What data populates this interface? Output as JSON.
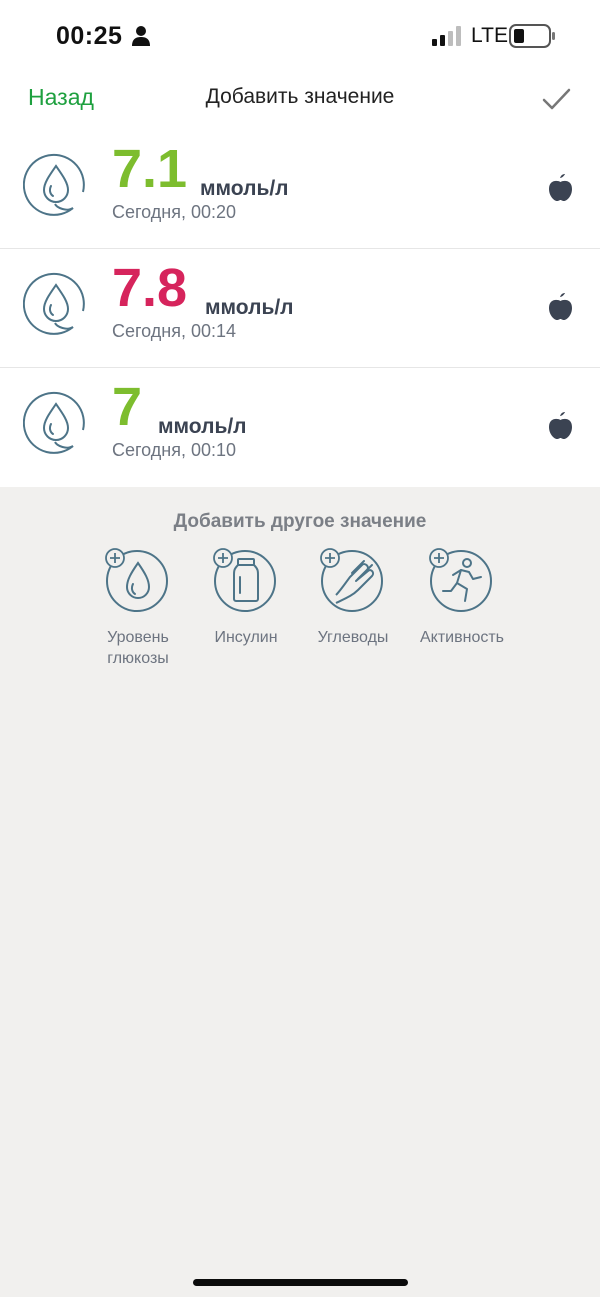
{
  "status_bar": {
    "time": "00:25",
    "network": "LTE"
  },
  "nav": {
    "back_label": "Назад",
    "title": "Добавить значение"
  },
  "entries": [
    {
      "value": "7.1",
      "unit": "ммоль/л",
      "time": "Сегодня, 00:20",
      "color": "#7dbd2e"
    },
    {
      "value": "7.8",
      "unit": "ммоль/л",
      "time": "Сегодня, 00:14",
      "color": "#d6245c"
    },
    {
      "value": "7",
      "unit": "ммоль/л",
      "time": "Сегодня, 00:10",
      "color": "#7dbd2e"
    }
  ],
  "add_other": {
    "title": "Добавить другое значение",
    "items": [
      {
        "label": "Уровень глюкозы",
        "icon": "glucose-icon"
      },
      {
        "label": "Инсулин",
        "icon": "insulin-icon"
      },
      {
        "label": "Углеводы",
        "icon": "carbs-icon"
      },
      {
        "label": "Активность",
        "icon": "activity-icon"
      }
    ]
  },
  "colors": {
    "accent_green": "#1ea03f",
    "value_green": "#7dbd2e",
    "value_red": "#d6245c",
    "icon_teal": "#4d7488"
  }
}
